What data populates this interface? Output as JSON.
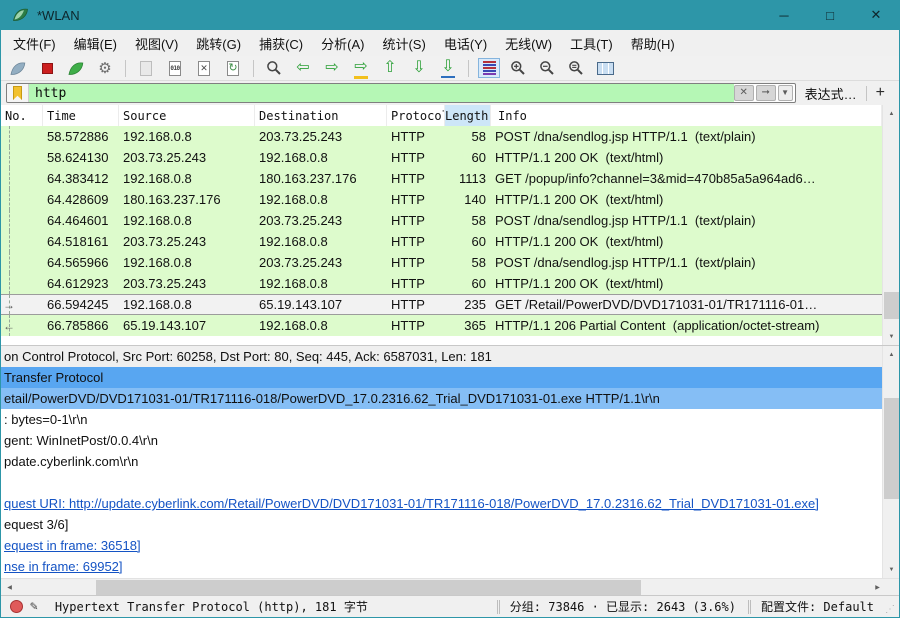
{
  "window": {
    "title": "*WLAN",
    "controls": {
      "minimize": "─",
      "maximize": "□",
      "close": "✕"
    }
  },
  "menu": {
    "items": [
      "文件(F)",
      "编辑(E)",
      "视图(V)",
      "跳转(G)",
      "捕获(C)",
      "分析(A)",
      "统计(S)",
      "电话(Y)",
      "无线(W)",
      "工具(T)",
      "帮助(H)"
    ]
  },
  "toolbar": {
    "buttons": [
      "capture-start",
      "capture-stop",
      "capture-restart",
      "capture-options",
      "save-file",
      "file-properties",
      "close-file",
      "reload-file",
      "find-packet",
      "go-back",
      "go-forward",
      "go-to-packet",
      "go-up",
      "go-down",
      "go-bottom",
      "colorize-packets",
      "zoom-in",
      "zoom-out",
      "zoom-reset",
      "resize-columns"
    ],
    "binary_label": "010"
  },
  "filter": {
    "value": "http",
    "clear_glyph": "✕",
    "apply_glyph": "➞",
    "dropdown_glyph": "▼",
    "expression_label": "表达式…",
    "add_label": "+"
  },
  "packet_table": {
    "columns": [
      "No.",
      "Time",
      "Source",
      "Destination",
      "Protocol",
      "Length",
      "Info"
    ],
    "sorted_column": "Length",
    "rows": [
      {
        "marker": "",
        "time": "58.572886",
        "source": "192.168.0.8",
        "destination": "203.73.25.243",
        "protocol": "HTTP",
        "length": "58",
        "info": "POST /dna/sendlog.jsp HTTP/1.1  (text/plain)",
        "selected": false
      },
      {
        "marker": "",
        "time": "58.624130",
        "source": "203.73.25.243",
        "destination": "192.168.0.8",
        "protocol": "HTTP",
        "length": "60",
        "info": "HTTP/1.1 200 OK  (text/html)",
        "selected": false
      },
      {
        "marker": "",
        "time": "64.383412",
        "source": "192.168.0.8",
        "destination": "180.163.237.176",
        "protocol": "HTTP",
        "length": "1113",
        "info": "GET /popup/info?channel=3&mid=470b85a5a964ad6…",
        "selected": false
      },
      {
        "marker": "",
        "time": "64.428609",
        "source": "180.163.237.176",
        "destination": "192.168.0.8",
        "protocol": "HTTP",
        "length": "140",
        "info": "HTTP/1.1 200 OK  (text/html)",
        "selected": false
      },
      {
        "marker": "",
        "time": "64.464601",
        "source": "192.168.0.8",
        "destination": "203.73.25.243",
        "protocol": "HTTP",
        "length": "58",
        "info": "POST /dna/sendlog.jsp HTTP/1.1  (text/plain)",
        "selected": false
      },
      {
        "marker": "",
        "time": "64.518161",
        "source": "203.73.25.243",
        "destination": "192.168.0.8",
        "protocol": "HTTP",
        "length": "60",
        "info": "HTTP/1.1 200 OK  (text/html)",
        "selected": false
      },
      {
        "marker": "",
        "time": "64.565966",
        "source": "192.168.0.8",
        "destination": "203.73.25.243",
        "protocol": "HTTP",
        "length": "58",
        "info": "POST /dna/sendlog.jsp HTTP/1.1  (text/plain)",
        "selected": false
      },
      {
        "marker": "",
        "time": "64.612923",
        "source": "203.73.25.243",
        "destination": "192.168.0.8",
        "protocol": "HTTP",
        "length": "60",
        "info": "HTTP/1.1 200 OK  (text/html)",
        "selected": false
      },
      {
        "marker": "request",
        "time": "66.594245",
        "source": "192.168.0.8",
        "destination": "65.19.143.107",
        "protocol": "HTTP",
        "length": "235",
        "info": "GET /Retail/PowerDVD/DVD171031-01/TR171116-01…",
        "selected": true
      },
      {
        "marker": "response",
        "time": "66.785866",
        "source": "65.19.143.107",
        "destination": "192.168.0.8",
        "protocol": "HTTP",
        "length": "365",
        "info": "HTTP/1.1 206 Partial Content  (application/octet-stream)",
        "selected": false
      }
    ]
  },
  "detail_pane": {
    "lines": [
      {
        "text": "on Control Protocol, Src Port: 60258, Dst Port: 80, Seq: 445, Ack: 6587031, Len: 181",
        "style": "muted"
      },
      {
        "text": "Transfer Protocol",
        "style": "selected"
      },
      {
        "text": "etail/PowerDVD/DVD171031-01/TR171116-018/PowerDVD_17.0.2316.62_Trial_DVD171031-01.exe HTTP/1.1\\r\\n",
        "style": "selected-child"
      },
      {
        "text": ": bytes=0-1\\r\\n",
        "style": ""
      },
      {
        "text": "gent: WinInetPost/0.0.4\\r\\n",
        "style": ""
      },
      {
        "text": "pdate.cyberlink.com\\r\\n",
        "style": ""
      },
      {
        "text": "",
        "style": ""
      },
      {
        "text": "quest URI: http://update.cyberlink.com/Retail/PowerDVD/DVD171031-01/TR171116-018/PowerDVD_17.0.2316.62_Trial_DVD171031-01.exe]",
        "style": "link"
      },
      {
        "text": "equest 3/6]",
        "style": ""
      },
      {
        "text": "equest in frame: 36518]",
        "style": "link"
      },
      {
        "text": "nse in frame: 69952]",
        "style": "link"
      }
    ]
  },
  "status_bar": {
    "left": "Hypertext Transfer Protocol (http), 181 字节",
    "counts": "分组: 73846   ·   已显示: 2643 (3.6%)",
    "profile": "配置文件: Default"
  }
}
